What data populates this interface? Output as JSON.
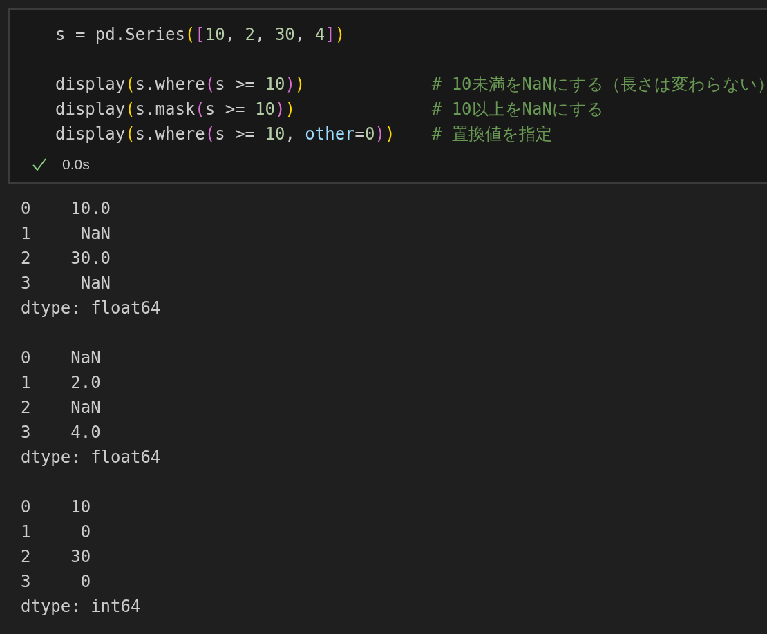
{
  "cell": {
    "code_blocks": [
      {
        "lines": [
          {
            "tokens": [
              {
                "kind": "plain",
                "text": "s = pd.Series"
              },
              {
                "kind": "bracket1",
                "text": "("
              },
              {
                "kind": "bracket2",
                "text": "["
              },
              {
                "kind": "number",
                "text": "10"
              },
              {
                "kind": "plain",
                "text": ", "
              },
              {
                "kind": "number",
                "text": "2"
              },
              {
                "kind": "plain",
                "text": ", "
              },
              {
                "kind": "number",
                "text": "30"
              },
              {
                "kind": "plain",
                "text": ", "
              },
              {
                "kind": "number",
                "text": "4"
              },
              {
                "kind": "bracket2",
                "text": "]"
              },
              {
                "kind": "bracket1",
                "text": ")"
              }
            ]
          }
        ]
      },
      {
        "lines": [
          {
            "tokens": [
              {
                "kind": "plain",
                "text": "display"
              },
              {
                "kind": "bracket1",
                "text": "("
              },
              {
                "kind": "plain",
                "text": "s.where"
              },
              {
                "kind": "bracket2",
                "text": "("
              },
              {
                "kind": "plain",
                "text": "s >= "
              },
              {
                "kind": "number",
                "text": "10"
              },
              {
                "kind": "bracket2",
                "text": ")"
              },
              {
                "kind": "bracket1",
                "text": ")"
              }
            ],
            "comment": "# 10未満をNaNにする（長さは変わらない）"
          },
          {
            "tokens": [
              {
                "kind": "plain",
                "text": "display"
              },
              {
                "kind": "bracket1",
                "text": "("
              },
              {
                "kind": "plain",
                "text": "s.mask"
              },
              {
                "kind": "bracket2",
                "text": "("
              },
              {
                "kind": "plain",
                "text": "s >= "
              },
              {
                "kind": "number",
                "text": "10"
              },
              {
                "kind": "bracket2",
                "text": ")"
              },
              {
                "kind": "bracket1",
                "text": ")"
              }
            ],
            "comment": "# 10以上をNaNにする"
          },
          {
            "tokens": [
              {
                "kind": "plain",
                "text": "display"
              },
              {
                "kind": "bracket1",
                "text": "("
              },
              {
                "kind": "plain",
                "text": "s.where"
              },
              {
                "kind": "bracket2",
                "text": "("
              },
              {
                "kind": "plain",
                "text": "s >= "
              },
              {
                "kind": "number",
                "text": "10"
              },
              {
                "kind": "plain",
                "text": ", "
              },
              {
                "kind": "param",
                "text": "other"
              },
              {
                "kind": "plain",
                "text": "="
              },
              {
                "kind": "number",
                "text": "0"
              },
              {
                "kind": "bracket2",
                "text": ")"
              },
              {
                "kind": "bracket1",
                "text": ")"
              }
            ],
            "comment": "# 置換値を指定"
          }
        ]
      }
    ],
    "status": {
      "succeeded": true,
      "time": "0.0s"
    }
  },
  "outputs": [
    {
      "lines": [
        "0    10.0",
        "1     NaN",
        "2    30.0",
        "3     NaN",
        "dtype: float64"
      ]
    },
    {
      "lines": [
        "0    NaN",
        "1    2.0",
        "2    NaN",
        "3    4.0",
        "dtype: float64"
      ]
    },
    {
      "lines": [
        "0    10",
        "1     0",
        "2    30",
        "3     0",
        "dtype: int64"
      ]
    }
  ]
}
